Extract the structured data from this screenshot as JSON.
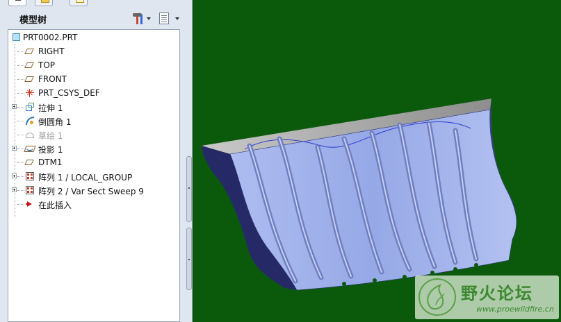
{
  "panel": {
    "title": "模型树",
    "tabs": [
      {
        "name": "model-tree",
        "icon": "model-tree-icon"
      },
      {
        "name": "folder-browser",
        "icon": "folder-icon"
      },
      {
        "name": "favorites",
        "icon": "favorites-icon"
      }
    ],
    "tools_icon": "tools-icon",
    "settings_icon": "settings-icon"
  },
  "tree": {
    "items": [
      {
        "label": "PRT0002.PRT",
        "icon": "part-icon",
        "expandable": false,
        "dimmed": false
      },
      {
        "label": "RIGHT",
        "icon": "datum-plane-icon",
        "expandable": false,
        "dimmed": false
      },
      {
        "label": "TOP",
        "icon": "datum-plane-icon",
        "expandable": false,
        "dimmed": false
      },
      {
        "label": "FRONT",
        "icon": "datum-plane-icon",
        "expandable": false,
        "dimmed": false
      },
      {
        "label": "PRT_CSYS_DEF",
        "icon": "coordinate-system-icon",
        "expandable": false,
        "dimmed": false
      },
      {
        "label": "拉伸 1",
        "icon": "extrude-icon",
        "expandable": true,
        "dimmed": false
      },
      {
        "label": "倒圆角 1",
        "icon": "round-icon",
        "expandable": false,
        "dimmed": false
      },
      {
        "label": "草绘 1",
        "icon": "sketch-icon",
        "expandable": false,
        "dimmed": true
      },
      {
        "label": "投影 1",
        "icon": "projection-icon",
        "expandable": true,
        "dimmed": false
      },
      {
        "label": "DTM1",
        "icon": "datum-plane-icon",
        "expandable": false,
        "dimmed": false
      },
      {
        "label": "阵列 1 / LOCAL_GROUP",
        "icon": "pattern-icon",
        "expandable": true,
        "dimmed": false
      },
      {
        "label": "阵列 2 / Var Sect Sweep 9",
        "icon": "pattern-icon",
        "expandable": true,
        "dimmed": false
      },
      {
        "label": "在此插入",
        "icon": "insert-here-icon",
        "expandable": false,
        "dimmed": false
      }
    ]
  },
  "viewport": {
    "background_color": "#0b5a0b",
    "model_color": "#9fb0ea",
    "edge_color": "#2a2f7a"
  },
  "watermark": {
    "title": "野火论坛",
    "url": "www.proewildfire.cn"
  }
}
